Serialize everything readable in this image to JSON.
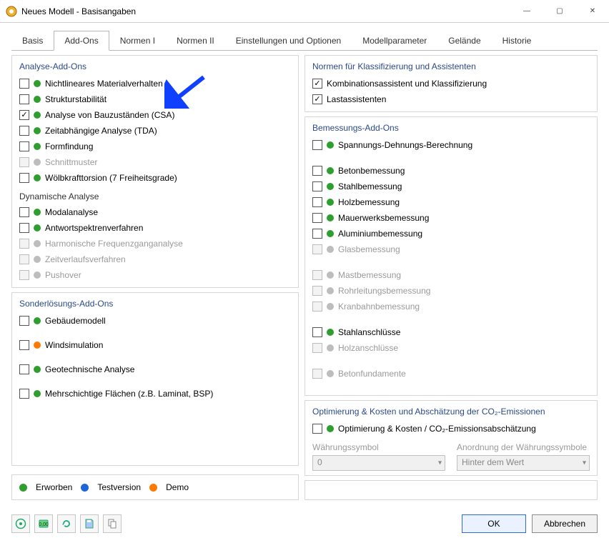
{
  "window": {
    "title": "Neues Modell - Basisangaben",
    "buttons": {
      "min": "—",
      "max": "▢",
      "close": "✕"
    }
  },
  "tabs": [
    {
      "label": "Basis",
      "active": false
    },
    {
      "label": "Add-Ons",
      "active": true
    },
    {
      "label": "Normen I",
      "active": false
    },
    {
      "label": "Normen II",
      "active": false
    },
    {
      "label": "Einstellungen und Optionen",
      "active": false
    },
    {
      "label": "Modellparameter",
      "active": false
    },
    {
      "label": "Gelände",
      "active": false
    },
    {
      "label": "Historie",
      "active": false
    }
  ],
  "left": {
    "analysis": {
      "title": "Analyse-Add-Ons",
      "items": [
        {
          "label": "Nichtlineares Materialverhalten",
          "dot": "green",
          "checked": false,
          "enabled": true
        },
        {
          "label": "Strukturstabilität",
          "dot": "green",
          "checked": false,
          "enabled": true
        },
        {
          "label": "Analyse von Bauzuständen (CSA)",
          "dot": "green",
          "checked": true,
          "enabled": true
        },
        {
          "label": "Zeitabhängige Analyse (TDA)",
          "dot": "green",
          "checked": false,
          "enabled": true
        },
        {
          "label": "Formfindung",
          "dot": "green",
          "checked": false,
          "enabled": true
        },
        {
          "label": "Schnittmuster",
          "dot": "grey",
          "checked": false,
          "enabled": false
        },
        {
          "label": "Wölbkrafttorsion (7 Freiheitsgrade)",
          "dot": "green",
          "checked": false,
          "enabled": true
        }
      ],
      "dynHeader": "Dynamische Analyse",
      "dyn": [
        {
          "label": "Modalanalyse",
          "dot": "green",
          "checked": false,
          "enabled": true
        },
        {
          "label": "Antwortspektrenverfahren",
          "dot": "green",
          "checked": false,
          "enabled": true
        },
        {
          "label": "Harmonische Frequenzganganalyse",
          "dot": "grey",
          "checked": false,
          "enabled": false
        },
        {
          "label": "Zeitverlaufsverfahren",
          "dot": "grey",
          "checked": false,
          "enabled": false
        },
        {
          "label": "Pushover",
          "dot": "grey",
          "checked": false,
          "enabled": false
        }
      ]
    },
    "special": {
      "title": "Sonderlösungs-Add-Ons",
      "items": [
        {
          "label": "Gebäudemodell",
          "dot": "green",
          "checked": false,
          "enabled": true
        },
        {
          "label": "Windsimulation",
          "dot": "orange",
          "checked": false,
          "enabled": true
        },
        {
          "label": "Geotechnische Analyse",
          "dot": "green",
          "checked": false,
          "enabled": true
        },
        {
          "label": "Mehrschichtige Flächen (z.B. Laminat, BSP)",
          "dot": "green",
          "checked": false,
          "enabled": true
        }
      ]
    }
  },
  "right": {
    "norms": {
      "title": "Normen für Klassifizierung und Assistenten",
      "items": [
        {
          "label": "Kombinationsassistent und Klassifizierung",
          "checked": true,
          "hasDot": false,
          "enabled": true
        },
        {
          "label": "Lastassistenten",
          "checked": true,
          "hasDot": false,
          "enabled": true
        }
      ]
    },
    "design": {
      "title": "Bemessungs-Add-Ons",
      "groups": [
        [
          {
            "label": "Spannungs-Dehnungs-Berechnung",
            "dot": "green",
            "checked": false,
            "enabled": true
          }
        ],
        [
          {
            "label": "Betonbemessung",
            "dot": "green",
            "checked": false,
            "enabled": true
          },
          {
            "label": "Stahlbemessung",
            "dot": "green",
            "checked": false,
            "enabled": true
          },
          {
            "label": "Holzbemessung",
            "dot": "green",
            "checked": false,
            "enabled": true
          },
          {
            "label": "Mauerwerksbemessung",
            "dot": "green",
            "checked": false,
            "enabled": true
          },
          {
            "label": "Aluminiumbemessung",
            "dot": "green",
            "checked": false,
            "enabled": true
          },
          {
            "label": "Glasbemessung",
            "dot": "grey",
            "checked": false,
            "enabled": false
          }
        ],
        [
          {
            "label": "Mastbemessung",
            "dot": "grey",
            "checked": false,
            "enabled": false
          },
          {
            "label": "Rohrleitungsbemessung",
            "dot": "grey",
            "checked": false,
            "enabled": false
          },
          {
            "label": "Kranbahnbemessung",
            "dot": "grey",
            "checked": false,
            "enabled": false
          }
        ],
        [
          {
            "label": "Stahlanschlüsse",
            "dot": "green",
            "checked": false,
            "enabled": true
          },
          {
            "label": "Holzanschlüsse",
            "dot": "grey",
            "checked": false,
            "enabled": false
          }
        ],
        [
          {
            "label": "Betonfundamente",
            "dot": "grey",
            "checked": false,
            "enabled": false
          }
        ]
      ]
    },
    "optim": {
      "title": "Optimierung & Kosten und Abschätzung der CO₂-Emissionen",
      "item": {
        "label": "Optimierung & Kosten / CO₂-Emissionsabschätzung",
        "dot": "green",
        "checked": false,
        "enabled": true
      },
      "currencyLabel": "Währungssymbol",
      "orderLabel": "Anordnung der Währungssymbole",
      "currencyValue": "0",
      "orderValue": "Hinter dem Wert"
    }
  },
  "legend": {
    "acquired": "Erworben",
    "test": "Testversion",
    "demo": "Demo"
  },
  "footer": {
    "ok": "OK",
    "cancel": "Abbrechen"
  }
}
